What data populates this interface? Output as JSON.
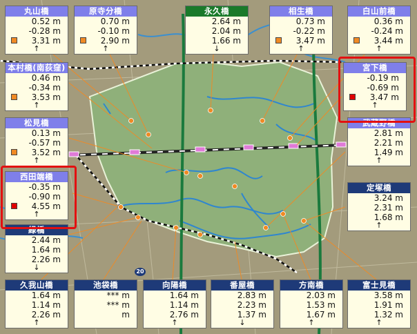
{
  "colors": {
    "orange": "#f08a24",
    "red": "#e00000",
    "header_purple": "#7f7fea",
    "header_green": "#1a7a2a",
    "header_navy": "#1e3a78",
    "area_green": "#8fb07a"
  },
  "highway_label": "20",
  "stations": [
    {
      "id": "maruyama",
      "name": "丸山橋",
      "header": "purple",
      "values": [
        "0.52 m",
        "-0.28 m",
        "3.31 m"
      ],
      "arrow": "↑",
      "marker": "orange"
    },
    {
      "id": "harateraburi",
      "name": "原寺分橋",
      "header": "purple",
      "values": [
        "0.70 m",
        "-0.10 m",
        "2.90 m"
      ],
      "arrow": "↑",
      "marker": "orange"
    },
    {
      "id": "eikyu",
      "name": "永久橋",
      "header": "green",
      "values": [
        "2.64 m",
        "2.04 m",
        "1.66 m"
      ],
      "arrow": "↓",
      "marker": ""
    },
    {
      "id": "aioi",
      "name": "相生橋",
      "header": "purple",
      "values": [
        "0.73 m",
        "-0.22 m",
        "3.47 m"
      ],
      "arrow": "↑",
      "marker": "orange"
    },
    {
      "id": "hakusanmae",
      "name": "白山前橋",
      "header": "purple",
      "values": [
        "0.36 m",
        "-0.24 m",
        "3.44 m"
      ],
      "arrow": "↑",
      "marker": "orange"
    },
    {
      "id": "honmura",
      "name": "本村橋(南荻窪)",
      "header": "purple",
      "values": [
        "0.46 m",
        "-0.34 m",
        "3.53 m"
      ],
      "arrow": "↑",
      "marker": "orange"
    },
    {
      "id": "miyashita",
      "name": "宮下橋",
      "header": "purple",
      "values": [
        "-0.19 m",
        "-0.69 m",
        "3.47 m"
      ],
      "arrow": "↑",
      "marker": "red"
    },
    {
      "id": "matsumi",
      "name": "松見橋",
      "header": "purple",
      "values": [
        "0.13 m",
        "-0.57 m",
        "3.52 m"
      ],
      "arrow": "↑",
      "marker": "orange"
    },
    {
      "id": "mushashisekibi",
      "name": "武蔵野橋",
      "header": "purple",
      "values": [
        "2.81 m",
        "2.21 m",
        "1.49 m"
      ],
      "arrow": "↑",
      "marker": ""
    },
    {
      "id": "nishitabata",
      "name": "西田端橋",
      "header": "purple",
      "values": [
        "-0.35 m",
        "-0.90 m",
        "4.55 m"
      ],
      "arrow": "↑",
      "marker": "red"
    },
    {
      "id": "jotsuka",
      "name": "定塚橋",
      "header": "navy",
      "values": [
        "3.24 m",
        "2.31 m",
        "1.68 m"
      ],
      "arrow": "↑",
      "marker": ""
    },
    {
      "id": "midori",
      "name": "緑橋",
      "header": "navy",
      "values": [
        "2.44 m",
        "1.64 m",
        "2.26 m"
      ],
      "arrow": "↓",
      "marker": ""
    },
    {
      "id": "kugayama",
      "name": "久我山橋",
      "header": "navy",
      "values": [
        "1.64 m",
        "1.14 m",
        "2.26 m"
      ],
      "arrow": "↑",
      "marker": ""
    },
    {
      "id": "ikebukuro",
      "name": "池袋橋",
      "header": "navy",
      "values": [
        "*** m",
        "*** m",
        "m"
      ],
      "arrow": "",
      "marker": ""
    },
    {
      "id": "mukohi",
      "name": "向陽橋",
      "header": "navy",
      "values": [
        "1.64 m",
        "1.14 m",
        "2.76 m"
      ],
      "arrow": "↑",
      "marker": ""
    },
    {
      "id": "banya",
      "name": "番屋橋",
      "header": "navy",
      "values": [
        "2.83 m",
        "2.23 m",
        "1.37 m"
      ],
      "arrow": "↓",
      "marker": ""
    },
    {
      "id": "honan",
      "name": "方南橋",
      "header": "navy",
      "values": [
        "2.03 m",
        "1.53 m",
        "1.67 m"
      ],
      "arrow": "↑",
      "marker": ""
    },
    {
      "id": "fujimi",
      "name": "富士見橋",
      "header": "navy",
      "values": [
        "3.58 m",
        "1.91 m",
        "1.32 m"
      ],
      "arrow": "↑",
      "marker": ""
    }
  ]
}
